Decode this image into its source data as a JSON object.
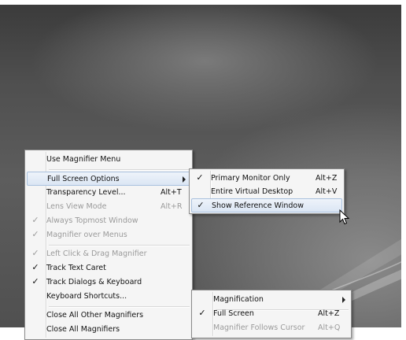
{
  "main_menu": {
    "items": [
      {
        "label": "Use Magnifier Menu",
        "checked": false,
        "disabled": false
      },
      {
        "label": "Full Screen Options",
        "checked": false,
        "disabled": false,
        "submenu": true,
        "highlighted": true
      },
      {
        "label": "Transparency Level...",
        "shortcut": "Alt+T",
        "checked": false,
        "disabled": false
      },
      {
        "label": "Lens View Mode",
        "shortcut": "Alt+R",
        "checked": false,
        "disabled": true
      },
      {
        "label": "Always Topmost Window",
        "checked": true,
        "disabled": true
      },
      {
        "label": "Magnifier over Menus",
        "checked": true,
        "disabled": true
      },
      {
        "label": "Left Click & Drag Magnifier",
        "checked": true,
        "disabled": true
      },
      {
        "label": "Track Text Caret",
        "checked": true,
        "disabled": false
      },
      {
        "label": "Track Dialogs & Keyboard",
        "checked": true,
        "disabled": false
      },
      {
        "label": "Keyboard Shortcuts...",
        "checked": false,
        "disabled": false
      },
      {
        "label": "Close All Other Magnifiers",
        "checked": false,
        "disabled": false
      },
      {
        "label": "Close All Magnifiers",
        "checked": false,
        "disabled": false
      }
    ]
  },
  "fullscreen_submenu": {
    "items": [
      {
        "label": "Primary Monitor Only",
        "shortcut": "Alt+Z",
        "checked": true
      },
      {
        "label": "Entire Virtual Desktop",
        "shortcut": "Alt+V",
        "checked": false
      },
      {
        "label": "Show Reference Window",
        "checked": true,
        "highlighted": true
      }
    ]
  },
  "second_menu": {
    "items": [
      {
        "label": "Magnification",
        "submenu": true
      },
      {
        "label": "Full Screen",
        "shortcut": "Alt+Z",
        "checked": true
      },
      {
        "label": "Magnifier Follows Cursor",
        "shortcut": "Alt+Q",
        "disabled": true
      }
    ]
  },
  "check_glyph": "✓",
  "icons": {
    "cursor": "mouse-pointer-icon",
    "submenu_arrow": "chevron-right-icon"
  }
}
